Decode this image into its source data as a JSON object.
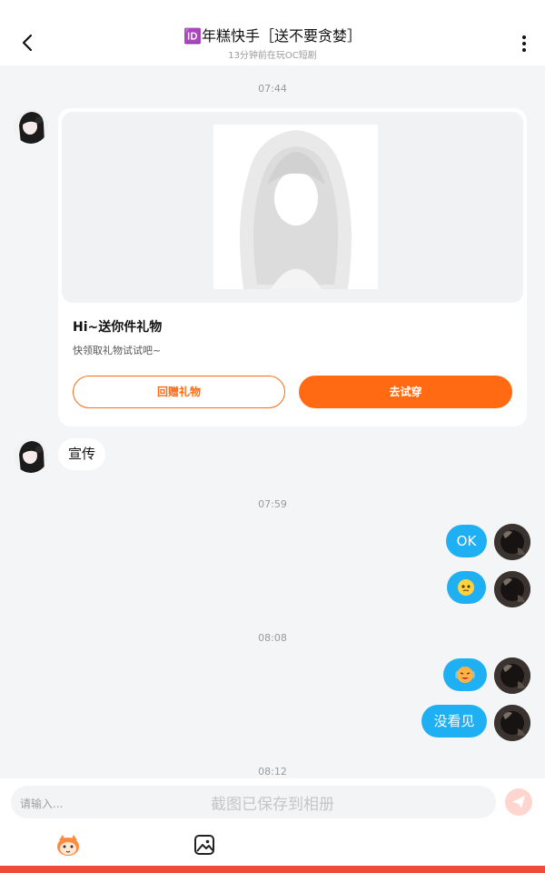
{
  "header": {
    "title": "🆔年糕快手［送不要贪婪］",
    "subtitle": "13分钟前在玩OC短剧"
  },
  "times": [
    "07:44",
    "07:59",
    "08:08",
    "08:12"
  ],
  "gift_card": {
    "title": "Hi~送你件礼物",
    "description": "快领取礼物试试吧~",
    "return_gift_label": "回赠礼物",
    "try_on_label": "去试穿"
  },
  "messages": {
    "incoming_text": "宣传",
    "outgoing_ok": "OK",
    "outgoing_missed": "没看见"
  },
  "input": {
    "placeholder": "请输入...",
    "toast": "截图已保存到相册"
  },
  "colors": {
    "accent": "#ff6a13",
    "bubble_blue": "#1fb0f4",
    "bottom_bar": "#f04a3a"
  }
}
